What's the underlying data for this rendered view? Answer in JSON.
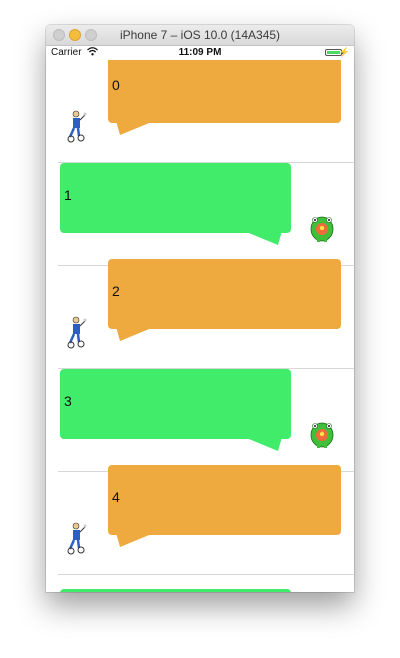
{
  "window": {
    "title": "iPhone 7 – iOS 10.0 (14A345)"
  },
  "status_bar": {
    "carrier": "Carrier",
    "time": "11:09 PM"
  },
  "messages": [
    {
      "text": "0",
      "side": "incoming",
      "color": "#eeaa3f",
      "avatar": "bike-rider-icon"
    },
    {
      "text": "1",
      "side": "outgoing",
      "color": "#42ec6b",
      "avatar": "green-monster-icon"
    },
    {
      "text": "2",
      "side": "incoming",
      "color": "#eeaa3f",
      "avatar": "bike-rider-icon"
    },
    {
      "text": "3",
      "side": "outgoing",
      "color": "#42ec6b",
      "avatar": "green-monster-icon"
    },
    {
      "text": "4",
      "side": "incoming",
      "color": "#eeaa3f",
      "avatar": "bike-rider-icon"
    },
    {
      "text": "",
      "side": "outgoing",
      "color": "#42ec6b",
      "avatar": ""
    }
  ]
}
